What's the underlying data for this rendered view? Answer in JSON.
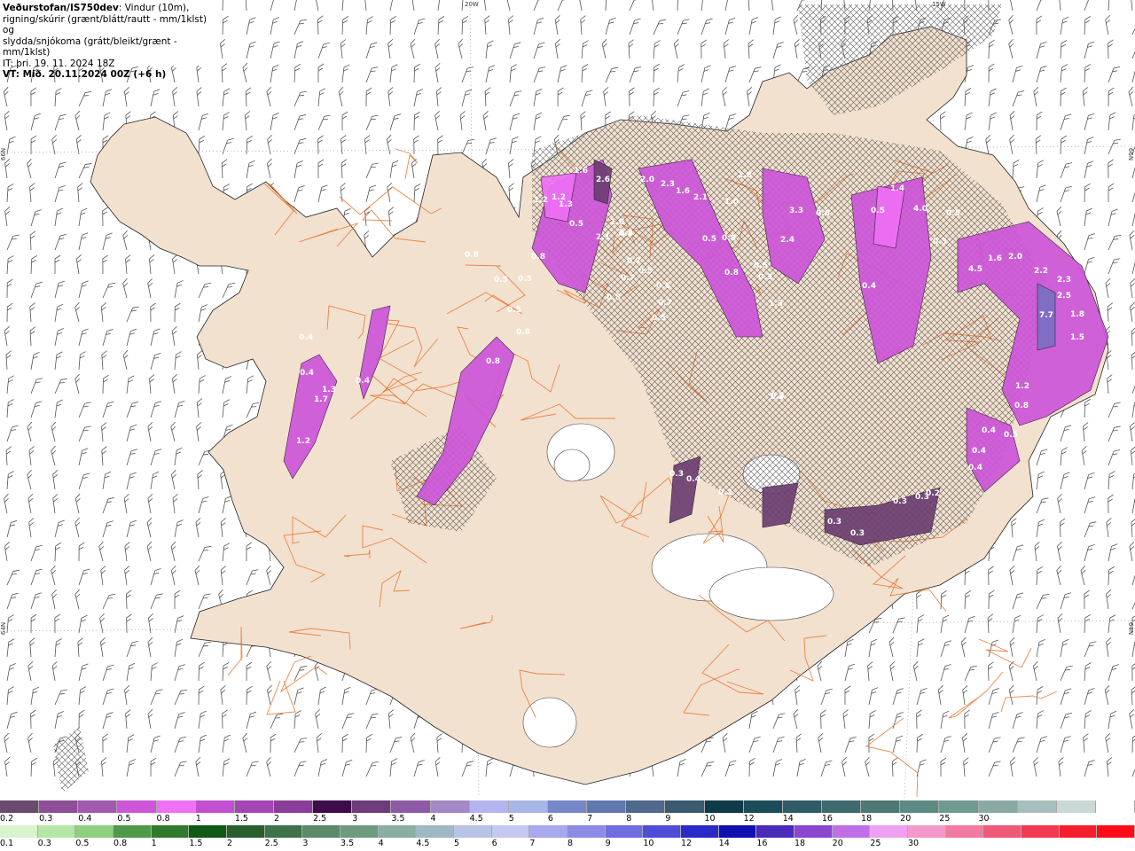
{
  "header": {
    "brand": "Veðurstofan/IS750dev",
    "desc_1": ": Vindur (10m),",
    "desc_2": "rigning/skúrir (grænt/blátt/rautt - mm/1klst) og",
    "desc_3": "slydda/snjókoma (grátt/bleikt/grænt - mm/1klst)",
    "it": "IT: þri. 19. 11. 2024 18Z",
    "vt": "VT: Mið. 20.11.2024 00Z (+6 h)"
  },
  "axis_labels": {
    "lon_20w": "20W",
    "lon_15w": "15W",
    "lat_66n_left": "66N",
    "lat_66n_right": "66N",
    "lat_64n_left": "64N",
    "lat_64n_right": "64N"
  },
  "colors": {
    "land": "#f3e1cf",
    "sea": "#ffffff",
    "roads": "#e8732f",
    "precip_main": "#cc55d8",
    "precip_dark": "#6b3e71",
    "precip_bright": "#ee70f4",
    "hatch": "#5a5a5a"
  },
  "map_labels": [
    {
      "text": "1.6"
    },
    {
      "text": "2.6"
    },
    {
      "text": "1.2"
    },
    {
      "text": "1.3"
    },
    {
      "text": "0.5"
    },
    {
      "text": "1.2"
    },
    {
      "text": "2.1"
    },
    {
      "text": "1.3"
    },
    {
      "text": "2.0"
    },
    {
      "text": "2.3"
    },
    {
      "text": "1.6"
    },
    {
      "text": "2.1"
    },
    {
      "text": "1.0"
    },
    {
      "text": "1.8"
    },
    {
      "text": "3.3"
    },
    {
      "text": "0.6"
    },
    {
      "text": "2.4"
    },
    {
      "text": "0.5"
    },
    {
      "text": "0.8"
    },
    {
      "text": "0.8"
    },
    {
      "text": "0.5"
    },
    {
      "text": "0.3"
    },
    {
      "text": "1.3"
    },
    {
      "text": "1.4"
    },
    {
      "text": "0.5"
    },
    {
      "text": "4.0"
    },
    {
      "text": "0.5"
    },
    {
      "text": "0.3"
    },
    {
      "text": "0.4"
    },
    {
      "text": "1.6"
    },
    {
      "text": "2.0"
    },
    {
      "text": "4.5"
    },
    {
      "text": "2.2"
    },
    {
      "text": "2.3"
    },
    {
      "text": "2.5"
    },
    {
      "text": "7.7"
    },
    {
      "text": "1.8"
    },
    {
      "text": "1.5"
    },
    {
      "text": "1.2"
    },
    {
      "text": "0.8"
    },
    {
      "text": "0.4"
    },
    {
      "text": "0.5"
    },
    {
      "text": "0.4"
    },
    {
      "text": "0.4"
    },
    {
      "text": "0.8"
    },
    {
      "text": "0.5"
    },
    {
      "text": "0.5"
    },
    {
      "text": "0.8"
    },
    {
      "text": "0.8"
    },
    {
      "text": "0.5"
    },
    {
      "text": "0.8"
    },
    {
      "text": "0.7"
    },
    {
      "text": "0.7"
    },
    {
      "text": "0.5"
    },
    {
      "text": "0.6"
    },
    {
      "text": "0.7"
    },
    {
      "text": "0.5"
    },
    {
      "text": "0.4"
    },
    {
      "text": "0.4"
    },
    {
      "text": "1.3"
    },
    {
      "text": "1.7"
    },
    {
      "text": "1.2"
    },
    {
      "text": "0.4"
    },
    {
      "text": "1.0"
    },
    {
      "text": "0.8"
    },
    {
      "text": "1.3"
    },
    {
      "text": "0.8"
    },
    {
      "text": "0.5"
    },
    {
      "text": "0.4"
    },
    {
      "text": "0.3"
    },
    {
      "text": "0.2"
    },
    {
      "text": "0.3"
    },
    {
      "text": "0.3"
    },
    {
      "text": "0.3"
    },
    {
      "text": "0.3"
    },
    {
      "text": "0.2"
    }
  ],
  "legend_snow": {
    "colors": [
      "#6b4a70",
      "#8d4f96",
      "#a15aad",
      "#cc55d8",
      "#ee70f4",
      "#c050d0",
      "#a545b6",
      "#8a3e99",
      "#3f0b4a",
      "#6f3b7a",
      "#8d5aa4",
      "#a288c4",
      "#b4b4ee",
      "#a8b6e6",
      "#7788c8",
      "#5f79b0",
      "#50688c",
      "#3a5a70",
      "#0f3a48",
      "#1c4c5a",
      "#2f5c66",
      "#3e6a6e",
      "#4d7874",
      "#5e8a84",
      "#6f9a92",
      "#8aa9a4",
      "#a9bfbd",
      "#cad8d6",
      "#ffffff"
    ],
    "ticks": [
      "0.2",
      "0.3",
      "0.4",
      "0.5",
      "0.8",
      "1",
      "1.5",
      "2",
      "2.5",
      "3",
      "3.5",
      "4",
      "4.5",
      "5",
      "6",
      "7",
      "8",
      "9",
      "10",
      "12",
      "14",
      "16",
      "18",
      "20",
      "25",
      "30"
    ]
  },
  "legend_rain": {
    "colors": [
      "#d8f5d0",
      "#b4e6a8",
      "#8fd07e",
      "#4f9a48",
      "#2f7a2c",
      "#0f5a14",
      "#285f2c",
      "#3e7248",
      "#5b8a68",
      "#6e9a80",
      "#8aaea0",
      "#a0b8c4",
      "#b8c4e6",
      "#c4c8f2",
      "#a8a8ee",
      "#8c8ce6",
      "#6e6ee0",
      "#4e4ed8",
      "#2a2ac8",
      "#1010b0",
      "#4a2ab8",
      "#8a46d0",
      "#c070e6",
      "#f0a0f0",
      "#f59ac8",
      "#f27aa0",
      "#ef5a78",
      "#f23a50",
      "#f51e2e",
      "#ff0c18"
    ],
    "ticks": [
      "0.1",
      "0.3",
      "0.5",
      "0.8",
      "1",
      "1.5",
      "2",
      "2.5",
      "3",
      "3.5",
      "4",
      "4.5",
      "5",
      "6",
      "7",
      "8",
      "9",
      "10",
      "12",
      "14",
      "16",
      "18",
      "20",
      "25",
      "30"
    ]
  }
}
